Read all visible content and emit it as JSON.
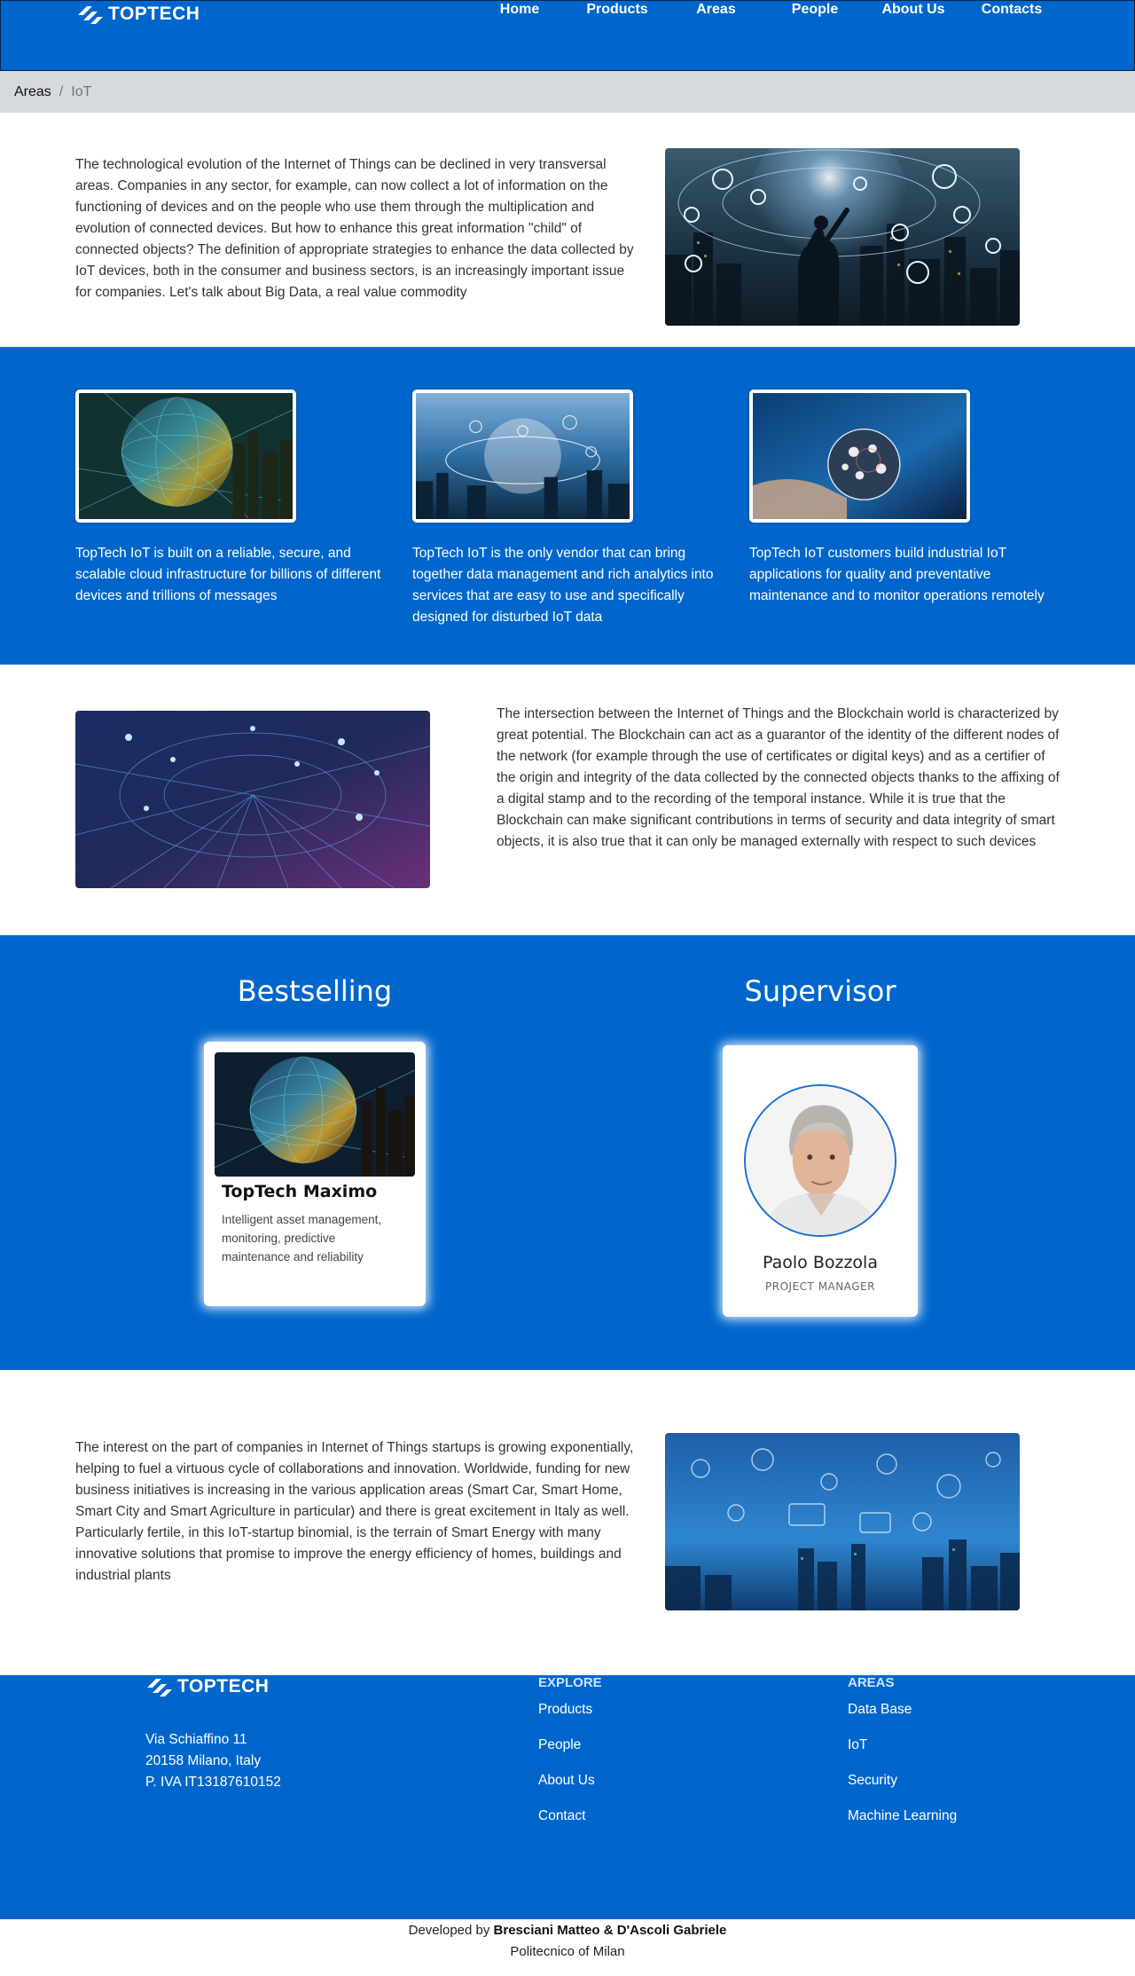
{
  "brand": {
    "name": "TOPTECH",
    "icon": "toptech-logo-icon"
  },
  "nav": {
    "items": [
      "Home",
      "Products",
      "Areas",
      "People",
      "About Us",
      "Contacts"
    ]
  },
  "breadcrumb": {
    "parent": "Areas",
    "separator": "/",
    "current": "IoT"
  },
  "intro": {
    "text": "The technological evolution of the Internet of Things can be declined in very transversal areas. Companies in any sector, for example, can now collect a lot of information on the functioning of devices and on the people who use them through the multiplication and evolution of connected devices. But how to enhance this great information \"child\" of connected objects? The definition of appropriate strategies to enhance the data collected by IoT devices, both in the consumer and business sectors, is an increasingly important issue for companies. Let's talk about Big Data, a real value commodity"
  },
  "features": [
    {
      "text": "TopTech IoT is built on a reliable, secure, and scalable cloud infrastructure for billions of different devices and trillions of messages"
    },
    {
      "text": "TopTech IoT is the only vendor that can bring together data management and rich analytics into services that are easy to use and specifically designed for disturbed IoT data"
    },
    {
      "text": "TopTech IoT customers build industrial IoT applications for quality and preventative maintenance and to monitor operations remotely"
    }
  ],
  "blockchain": {
    "text": "The intersection between the Internet of Things and the Blockchain world is characterized by great potential. The Blockchain can act as a guarantor of the identity of the different nodes of the network (for example through the use of certificates or digital keys) and as a certifier of the origin and integrity of the data collected by the connected objects thanks to the affixing of a digital stamp and to the recording of the temporal instance. While it is true that the Blockchain can make significant contributions in terms of security and data integrity of smart objects, it is also true that it can only be managed externally with respect to such devices"
  },
  "showcase": {
    "bestselling_title": "Bestselling",
    "supervisor_title": "Supervisor",
    "product": {
      "name": "TopTech Maximo",
      "description": "Intelligent asset management, monitoring, predictive maintenance and reliability"
    },
    "supervisor": {
      "name": "Paolo Bozzola",
      "role": "PROJECT MANAGER"
    }
  },
  "startups": {
    "text": "The interest on the part of companies in Internet of Things startups is growing exponentially, helping to fuel a virtuous cycle of collaborations and innovation. Worldwide, funding for new business initiatives is increasing in the various application areas (Smart Car, Smart Home, Smart City and Smart Agriculture in particular) and there is great excitement in Italy as well. Particularly fertile, in this IoT-startup binomial, is the terrain of Smart Energy with many innovative solutions that promise to improve the energy efficiency of homes, buildings and industrial plants"
  },
  "footer": {
    "address": [
      "Via Schiaffino 11",
      "20158 Milano, Italy",
      "P. IVA IT13187610152"
    ],
    "explore": {
      "title": "EXPLORE",
      "links": [
        "Products",
        "People",
        "About Us",
        "Contact"
      ]
    },
    "areas": {
      "title": "AREAS",
      "links": [
        "Data Base",
        "IoT",
        "Security",
        "Machine Learning"
      ]
    }
  },
  "credits": {
    "prefix": "Developed by",
    "authors": "Bresciani Matteo & D'Ascoli Gabriele",
    "institution": "Politecnico of Milan"
  },
  "colors": {
    "primary_blue": "#0066cc",
    "breadcrumb_bg": "#d6d9de"
  }
}
